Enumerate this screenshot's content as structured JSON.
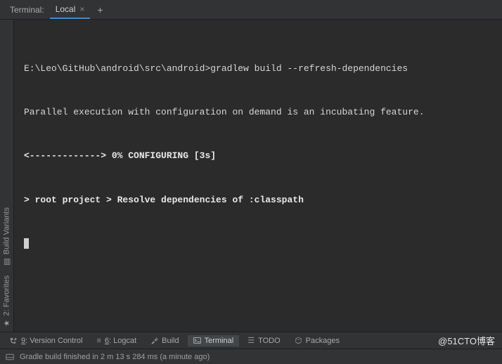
{
  "header": {
    "title": "Terminal:",
    "tab_label": "Local",
    "tab_close": "×",
    "add_tab": "+"
  },
  "terminal": {
    "lines": [
      {
        "text": "E:\\Leo\\GitHub\\android\\src\\android>gradlew build --refresh-dependencies",
        "bold": false
      },
      {
        "text": "Parallel execution with configuration on demand is an incubating feature.",
        "bold": false
      },
      {
        "text": "<-------------> 0% CONFIGURING [3s]",
        "bold": true
      },
      {
        "text": "> root project > Resolve dependencies of :classpath",
        "bold": true
      }
    ]
  },
  "side": {
    "build_variants": "Build Variants",
    "favorites": "2: Favorites"
  },
  "bottom": {
    "version_control": {
      "key": "9",
      "label": ": Version Control"
    },
    "logcat": {
      "key": "6",
      "label": ": Logcat"
    },
    "build": "Build",
    "terminal": "Terminal",
    "todo": "TODO",
    "packages": "Packages"
  },
  "watermark": "@51CTO博客",
  "status": {
    "message": "Gradle build finished in 2 m 13 s 284 ms (a minute ago)"
  }
}
